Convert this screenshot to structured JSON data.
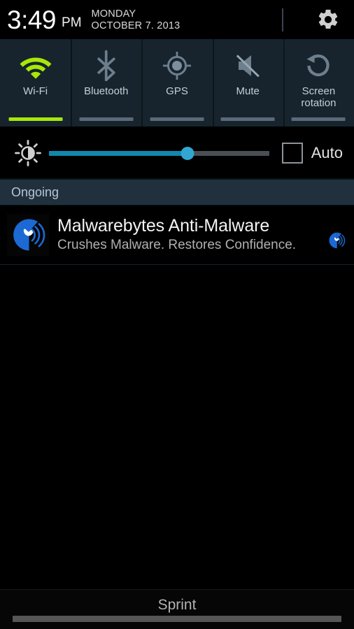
{
  "statusbar": {
    "time": "3:49",
    "ampm": "PM",
    "day": "MONDAY",
    "date": "OCTOBER 7. 2013",
    "settings_icon": "gear-icon"
  },
  "quick_settings": {
    "tiles": [
      {
        "label": "Wi-Fi",
        "icon": "wifi-icon",
        "active": true,
        "icon_color": "#a7e808",
        "underline_color": "#a7e808"
      },
      {
        "label": "Bluetooth",
        "icon": "bluetooth-icon",
        "active": false,
        "icon_color": "#6d7f8d",
        "underline_color": "#5b6a77"
      },
      {
        "label": "GPS",
        "icon": "gps-icon",
        "active": false,
        "icon_color": "#6d7f8d",
        "underline_color": "#5b6a77"
      },
      {
        "label": "Mute",
        "icon": "mute-icon",
        "active": false,
        "icon_color": "#6d7f8d",
        "underline_color": "#5b6a77"
      },
      {
        "label": "Screen\nrotation",
        "icon": "screen-rotation-icon",
        "active": false,
        "icon_color": "#6d7f8d",
        "underline_color": "#5b6a77"
      }
    ]
  },
  "brightness": {
    "icon": "brightness-icon",
    "value_percent": 63,
    "fill_color": "#1286ac",
    "thumb_color": "#31a6d0",
    "track_color": "#4a4f55",
    "auto_label": "Auto",
    "auto_checked": false
  },
  "notifications": {
    "section_header": "Ongoing",
    "items": [
      {
        "app_icon": "malwarebytes-icon",
        "title": "Malwarebytes Anti-Malware",
        "subtitle": "Crushes Malware. Restores Confidence.",
        "badge_icon": "malwarebytes-badge-icon",
        "brand_color": "#1c69d4"
      }
    ]
  },
  "bottom": {
    "carrier": "Sprint",
    "handle": "drag-handle"
  }
}
